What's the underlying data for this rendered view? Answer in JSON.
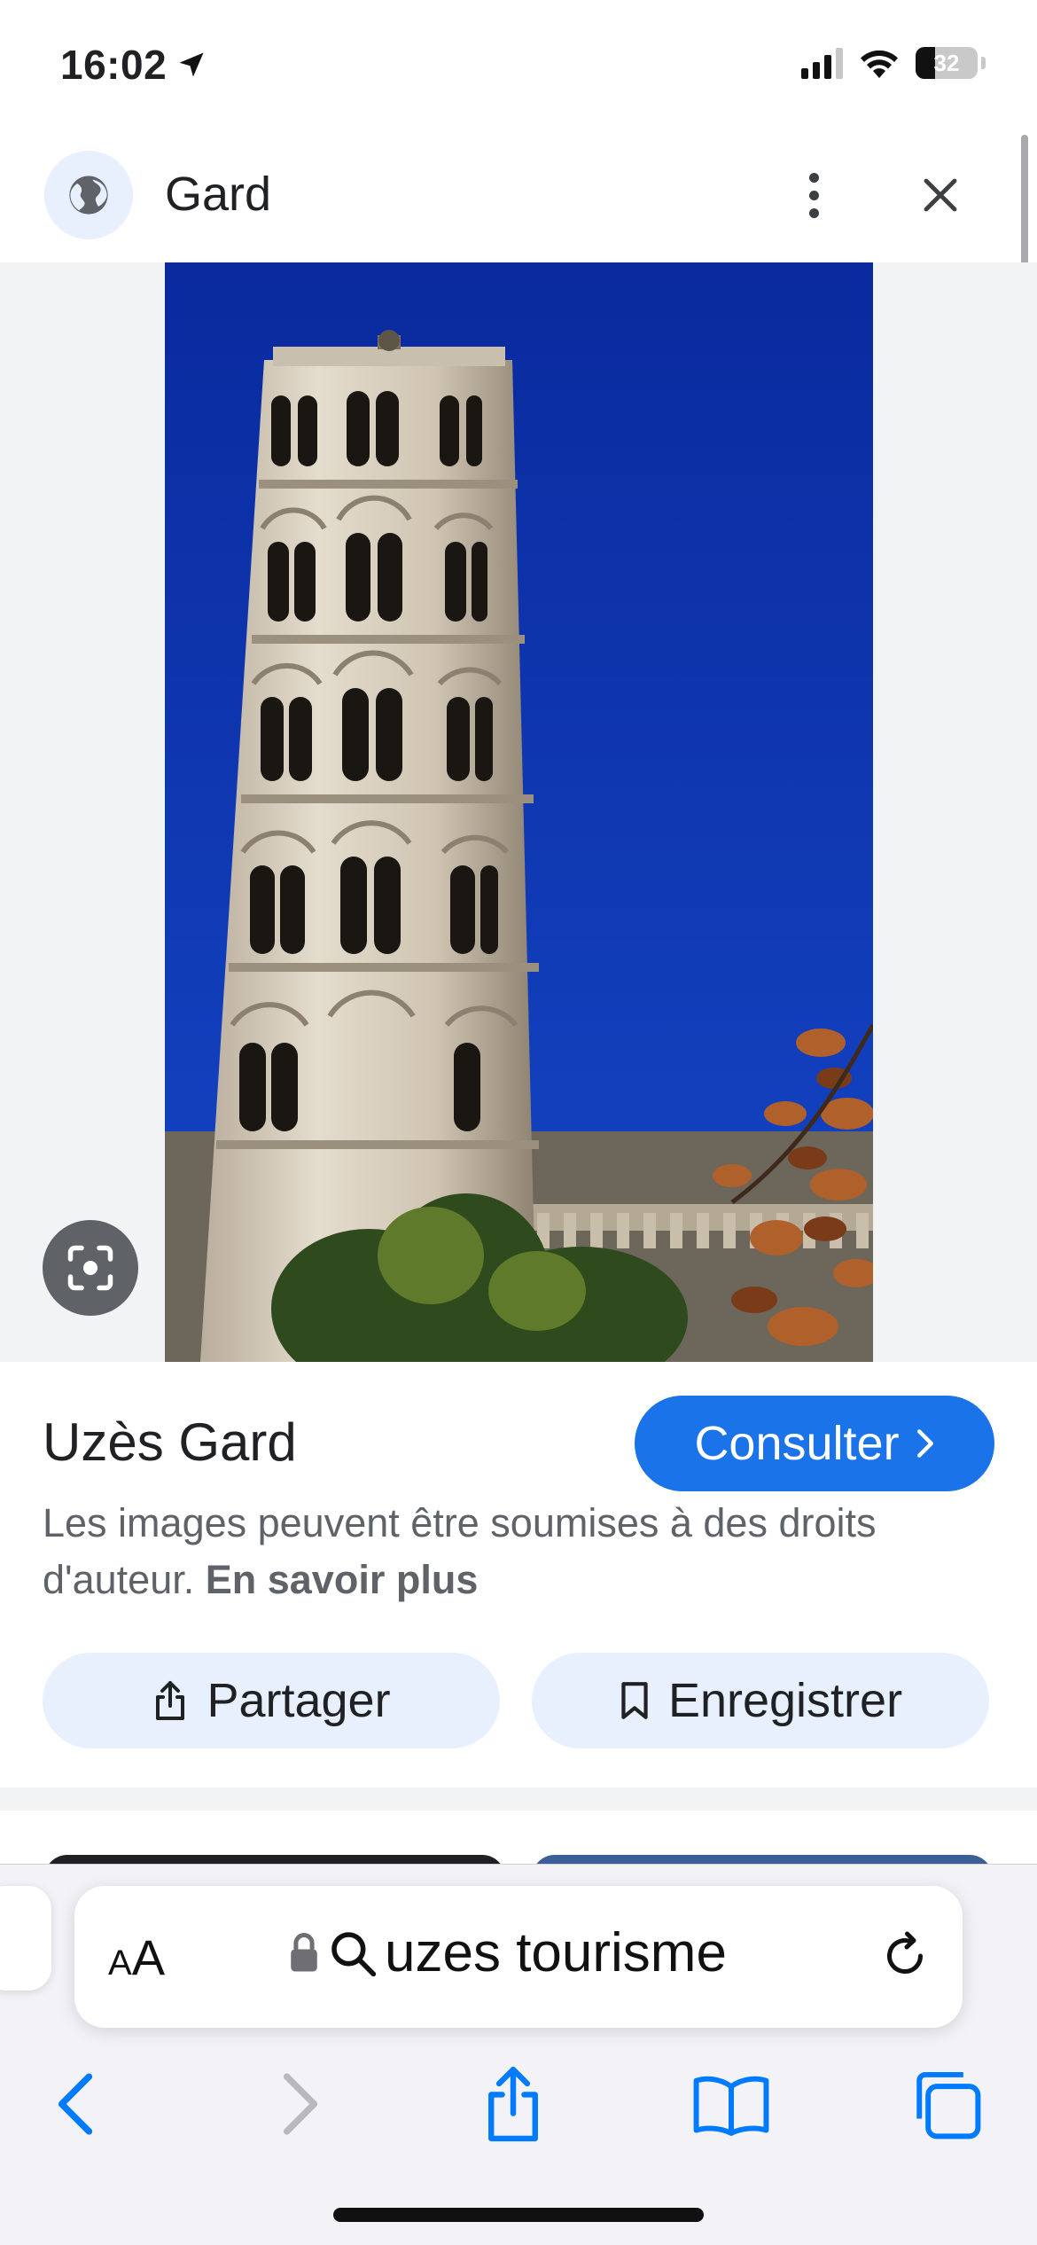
{
  "status_bar": {
    "time": "16:02",
    "battery": "32",
    "battery_level": 0.32
  },
  "header": {
    "title": "Gard"
  },
  "result": {
    "title": "Uzès Gard",
    "consult_label": "Consulter",
    "copyright_text": "Les images peuvent être soumises à des droits d'auteur.",
    "learn_more": "En savoir plus",
    "share_label": "Partager",
    "save_label": "Enregistrer"
  },
  "safari": {
    "aa_small": "A",
    "aa_large": "A",
    "url_text": "uzes tourisme"
  },
  "colors": {
    "accent": "#1a73e8",
    "chip_bg": "#e8f0fe",
    "safari_blue": "#007aff",
    "sky": "#0b2fa6"
  }
}
